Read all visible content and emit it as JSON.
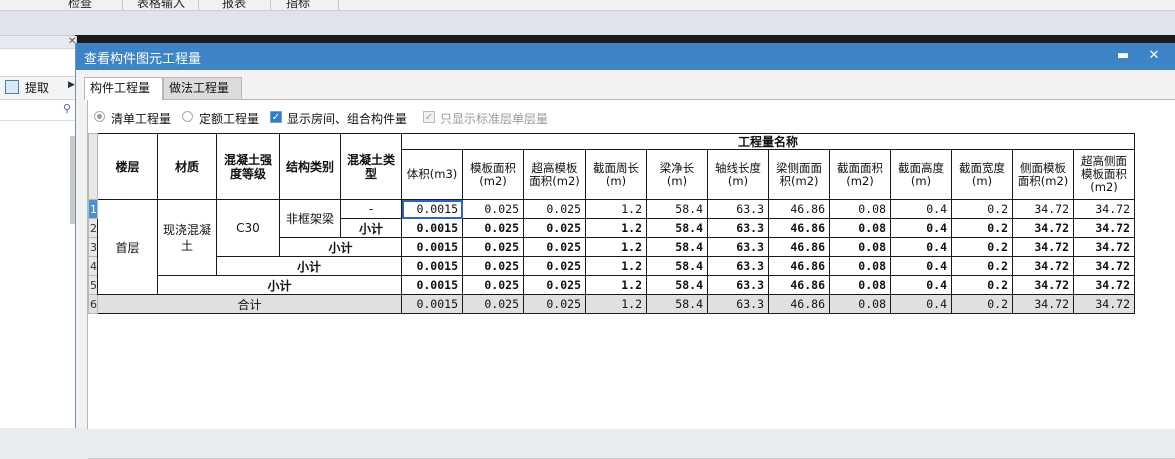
{
  "app": {
    "menu": [
      "检查",
      "表格输入",
      "报表",
      "指标"
    ],
    "left_panel": {
      "extract_label": "提取"
    }
  },
  "dialog": {
    "title": "查看构件图元工程量",
    "controls": {
      "minimize": "▬",
      "close": "✕"
    },
    "tabs": [
      {
        "label": "构件工程量",
        "active": true
      },
      {
        "label": "做法工程量",
        "active": false
      }
    ],
    "options": {
      "list_quantity": {
        "label": "清单工程量",
        "checked": true
      },
      "quota_quantity": {
        "label": "定额工程量",
        "checked": false
      },
      "show_room_combo": {
        "label": "显示房间、组合构件量",
        "checked": true
      },
      "show_std_floor": {
        "label": "只显示标准层单层量",
        "checked": true,
        "disabled": true
      }
    },
    "table": {
      "headers": {
        "floor": "楼层",
        "material": "材质",
        "grade": "混凝土强度等级",
        "struct_type": "结构类别",
        "concrete_type": "混凝土类型",
        "group": "工程量名称",
        "columns": [
          "体积(m3)",
          "模板面积(m2)",
          "超高模板面积(m2)",
          "截面周长(m)",
          "梁净长(m)",
          "轴线长度(m)",
          "梁侧面面积(m2)",
          "截面面积(m2)",
          "截面高度(m)",
          "截面宽度(m)",
          "侧面模板面积(m2)",
          "超高侧面模板面积(m2)"
        ]
      },
      "row_numbers": [
        "1",
        "2",
        "3",
        "4",
        "5",
        "6"
      ],
      "floor": "首层",
      "material": "现浇混凝土",
      "grade": "C30",
      "struct_type": "非框架梁",
      "concrete_type": "-",
      "subtotal_label": "小计",
      "total_label": "合计",
      "values": [
        "0.0015",
        "0.025",
        "0.025",
        "1.2",
        "58.4",
        "63.3",
        "46.86",
        "0.08",
        "0.4",
        "0.2",
        "34.72",
        "34.72"
      ]
    }
  }
}
